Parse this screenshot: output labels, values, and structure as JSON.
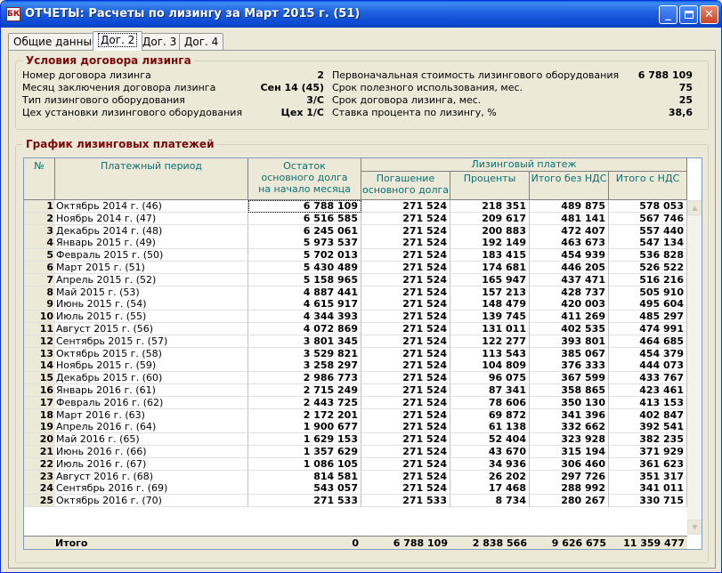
{
  "window": {
    "icon_text": "БК",
    "title": "ОТЧЕТЫ: Расчеты по лизингу за Март 2015 г. (51)",
    "min_symbol": "_",
    "close_symbol": "✕"
  },
  "tabs": [
    {
      "label": "Общие данные",
      "active": false
    },
    {
      "label": "Дог. 2",
      "active": true
    },
    {
      "label": "Дог. 3",
      "active": false
    },
    {
      "label": "Дог. 4",
      "active": false
    }
  ],
  "conditions": {
    "title": "Условия договора лизинга",
    "left": [
      {
        "label": "Номер договора лизинга",
        "value": "2"
      },
      {
        "label": "Месяц заключения договора лизинга",
        "value": "Сен 14 (45)"
      },
      {
        "label": "Тип лизингового оборудования",
        "value": "3/С"
      },
      {
        "label": "Цех установки лизингового оборудования",
        "value": "Цех 1/С"
      }
    ],
    "right": [
      {
        "label": "Первоначальная стоимость лизингового оборудования",
        "value": "6 788 109"
      },
      {
        "label": "Срок полезного использования, мес.",
        "value": "75"
      },
      {
        "label": "Срок договора лизинга, мес.",
        "value": "25"
      },
      {
        "label": "Ставка процента по лизингу, %",
        "value": "38,6"
      }
    ]
  },
  "schedule": {
    "title": "График лизинговых платежей",
    "headers": {
      "num": "№",
      "period": "Платежный период",
      "balance": "Остаток основного долга на начало месяца",
      "payment": "Лизинговый платеж",
      "repayment": "Погашение основного долга",
      "interest": "Проценты",
      "total_no_vat": "Итого без НДС",
      "total_vat": "Итого с НДС"
    },
    "rows": [
      [
        "1",
        "Октябрь 2014 г. (46)",
        "6 788 109",
        "271 524",
        "218 351",
        "489 875",
        "578 053"
      ],
      [
        "2",
        "Ноябрь 2014 г. (47)",
        "6 516 585",
        "271 524",
        "209 617",
        "481 141",
        "567 746"
      ],
      [
        "3",
        "Декабрь 2014 г. (48)",
        "6 245 061",
        "271 524",
        "200 883",
        "472 407",
        "557 440"
      ],
      [
        "4",
        "Январь 2015 г. (49)",
        "5 973 537",
        "271 524",
        "192 149",
        "463 673",
        "547 134"
      ],
      [
        "5",
        "Февраль 2015 г. (50)",
        "5 702 013",
        "271 524",
        "183 415",
        "454 939",
        "536 828"
      ],
      [
        "6",
        "Март 2015 г. (51)",
        "5 430 489",
        "271 524",
        "174 681",
        "446 205",
        "526 522"
      ],
      [
        "7",
        "Апрель 2015 г. (52)",
        "5 158 965",
        "271 524",
        "165 947",
        "437 471",
        "516 216"
      ],
      [
        "8",
        "Май 2015 г. (53)",
        "4 887 441",
        "271 524",
        "157 213",
        "428 737",
        "505 910"
      ],
      [
        "9",
        "Июнь 2015 г. (54)",
        "4 615 917",
        "271 524",
        "148 479",
        "420 003",
        "495 604"
      ],
      [
        "10",
        "Июль 2015 г. (55)",
        "4 344 393",
        "271 524",
        "139 745",
        "411 269",
        "485 297"
      ],
      [
        "11",
        "Август 2015 г. (56)",
        "4 072 869",
        "271 524",
        "131 011",
        "402 535",
        "474 991"
      ],
      [
        "12",
        "Сентябрь 2015 г. (57)",
        "3 801 345",
        "271 524",
        "122 277",
        "393 801",
        "464 685"
      ],
      [
        "13",
        "Октябрь 2015 г. (58)",
        "3 529 821",
        "271 524",
        "113 543",
        "385 067",
        "454 379"
      ],
      [
        "14",
        "Ноябрь 2015 г. (59)",
        "3 258 297",
        "271 524",
        "104 809",
        "376 333",
        "444 073"
      ],
      [
        "15",
        "Декабрь 2015 г. (60)",
        "2 986 773",
        "271 524",
        "96 075",
        "367 599",
        "433 767"
      ],
      [
        "16",
        "Январь 2016 г. (61)",
        "2 715 249",
        "271 524",
        "87 341",
        "358 865",
        "423 461"
      ],
      [
        "17",
        "Февраль 2016 г. (62)",
        "2 443 725",
        "271 524",
        "78 606",
        "350 130",
        "413 153"
      ],
      [
        "18",
        "Март 2016 г. (63)",
        "2 172 201",
        "271 524",
        "69 872",
        "341 396",
        "402 847"
      ],
      [
        "19",
        "Апрель 2016 г. (64)",
        "1 900 677",
        "271 524",
        "61 138",
        "332 662",
        "392 541"
      ],
      [
        "20",
        "Май 2016 г. (65)",
        "1 629 153",
        "271 524",
        "52 404",
        "323 928",
        "382 235"
      ],
      [
        "21",
        "Июнь 2016 г. (66)",
        "1 357 629",
        "271 524",
        "43 670",
        "315 194",
        "371 929"
      ],
      [
        "22",
        "Июль 2016 г. (67)",
        "1 086 105",
        "271 524",
        "34 936",
        "306 460",
        "361 623"
      ],
      [
        "23",
        "Август 2016 г. (68)",
        "814 581",
        "271 524",
        "26 202",
        "297 726",
        "351 317"
      ],
      [
        "24",
        "Сентябрь 2016 г. (69)",
        "543 057",
        "271 524",
        "17 468",
        "288 992",
        "341 011"
      ],
      [
        "25",
        "Октябрь 2016 г. (70)",
        "271 533",
        "271 533",
        "8 734",
        "280 267",
        "330 715"
      ]
    ],
    "totals": {
      "label": "Итого",
      "balance": "0",
      "repayment": "6 788 109",
      "interest": "2 838 566",
      "total_no_vat": "9 626 675",
      "total_vat": "11 359 477"
    },
    "scroll_up": "▲",
    "scroll_down": "▼"
  }
}
